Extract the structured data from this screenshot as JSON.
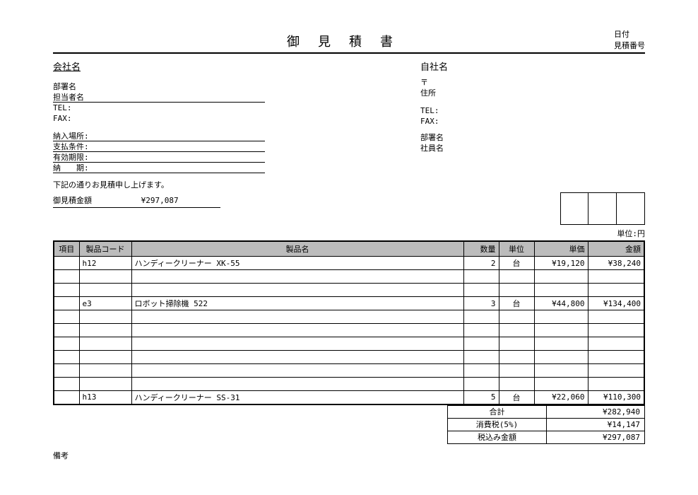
{
  "header": {
    "title": "御見積書",
    "date_label": "日付",
    "quote_no_label": "見積番号"
  },
  "client": {
    "company_label": "会社名",
    "dept_label": "部署名",
    "person_label": "担当者名",
    "tel_label": "TEL:",
    "fax_label": "FAX:",
    "delivery_place_label": "納入場所:",
    "payment_terms_label": "支払条件:",
    "valid_until_label": "有効期限:",
    "delivery_date_label": "納　　期:"
  },
  "self": {
    "company_label": "自社名",
    "postal_label": "〒",
    "address_label": "住所",
    "tel_label": "TEL:",
    "fax_label": "FAX:",
    "dept_label": "部署名",
    "staff_label": "社員名"
  },
  "intro_text": "下記の通りお見積申し上げます。",
  "total": {
    "label": "御見積金額",
    "amount": "¥297,087"
  },
  "unit_note": "単位:円",
  "columns": {
    "item": "項目",
    "code": "製品コード",
    "name": "製品名",
    "qty": "数量",
    "unit": "単位",
    "price": "単価",
    "amount": "金額"
  },
  "rows": [
    {
      "code": "h12",
      "name": "ハンディークリーナー XK-55",
      "qty": "2",
      "unit": "台",
      "price": "¥19,120",
      "amount": "¥38,240"
    },
    {},
    {},
    {
      "code": "e3",
      "name": "ロボット掃除機 522",
      "qty": "3",
      "unit": "台",
      "price": "¥44,800",
      "amount": "¥134,400"
    },
    {},
    {},
    {},
    {},
    {},
    {},
    {
      "code": "h13",
      "name": "ハンディークリーナー SS-31",
      "qty": "5",
      "unit": "台",
      "price": "¥22,060",
      "amount": "¥110,300"
    }
  ],
  "summary": {
    "subtotal_label": "合計",
    "subtotal": "¥282,940",
    "tax_label": "消費税(5%)",
    "tax": "¥14,147",
    "total_label": "税込み金額",
    "total": "¥297,087"
  },
  "remarks_label": "備考"
}
